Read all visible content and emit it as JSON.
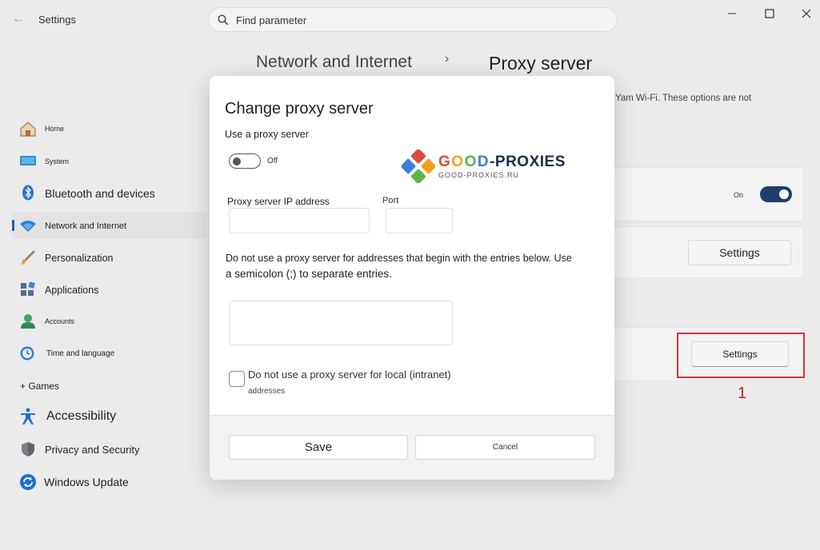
{
  "app": {
    "title": "Settings"
  },
  "search": {
    "placeholder": "Find parameter"
  },
  "breadcrumb": {
    "parent": "Network and Internet",
    "separator": "›",
    "current": "Proxy server"
  },
  "page": {
    "description": "Yam Wi-Fi. These options are not"
  },
  "sidebar": {
    "items": [
      {
        "label": "Home",
        "icon": "home-icon"
      },
      {
        "label": "System",
        "icon": "system-icon"
      },
      {
        "label": "Bluetooth and devices",
        "icon": "bluetooth-icon"
      },
      {
        "label": "Network and Internet",
        "icon": "wifi-icon",
        "active": true
      },
      {
        "label": "Personalization",
        "icon": "brush-icon"
      },
      {
        "label": "Applications",
        "icon": "apps-icon"
      },
      {
        "label": "Accounts",
        "icon": "account-icon"
      },
      {
        "label": "Time and language",
        "icon": "clock-icon"
      },
      {
        "label": "+ Games",
        "icon": ""
      },
      {
        "label": "Accessibility",
        "icon": "accessibility-icon"
      },
      {
        "label": "Privacy and Security",
        "icon": "shield-icon"
      },
      {
        "label": "Windows Update",
        "icon": "update-icon"
      }
    ]
  },
  "main": {
    "auto_detect": {
      "state_label": "On",
      "enabled": true
    },
    "setup_script": {
      "button_label": "Settings"
    },
    "manual_proxy": {
      "button_label": "Settings"
    },
    "annotation": {
      "step_number": "1",
      "color": "#e0303a"
    }
  },
  "dialog": {
    "title": "Change proxy server",
    "use_proxy_label": "Use a proxy server",
    "use_proxy_state": "Off",
    "ip_label": "Proxy server IP address",
    "port_label": "Port",
    "ip_value": "",
    "port_value": "",
    "exceptions_line1": "Do not use a proxy server for addresses that begin with the entries below. Use",
    "exceptions_line2": "a semicolon (;) to separate entries.",
    "exceptions_value": "",
    "local_label_line1": "Do not use a proxy server for local (intranet)",
    "local_label_line2": "addresses",
    "save_label": "Save",
    "cancel_label": "Cancel"
  },
  "watermark": {
    "brand_g": "G",
    "brand_o1": "O",
    "brand_o2": "O",
    "brand_d": "D",
    "brand_rest": "-PROXIES",
    "domain": "GOOD-PROXIES.RU"
  },
  "colors": {
    "accent": "#1f3d6e",
    "highlight": "#e0303a"
  }
}
